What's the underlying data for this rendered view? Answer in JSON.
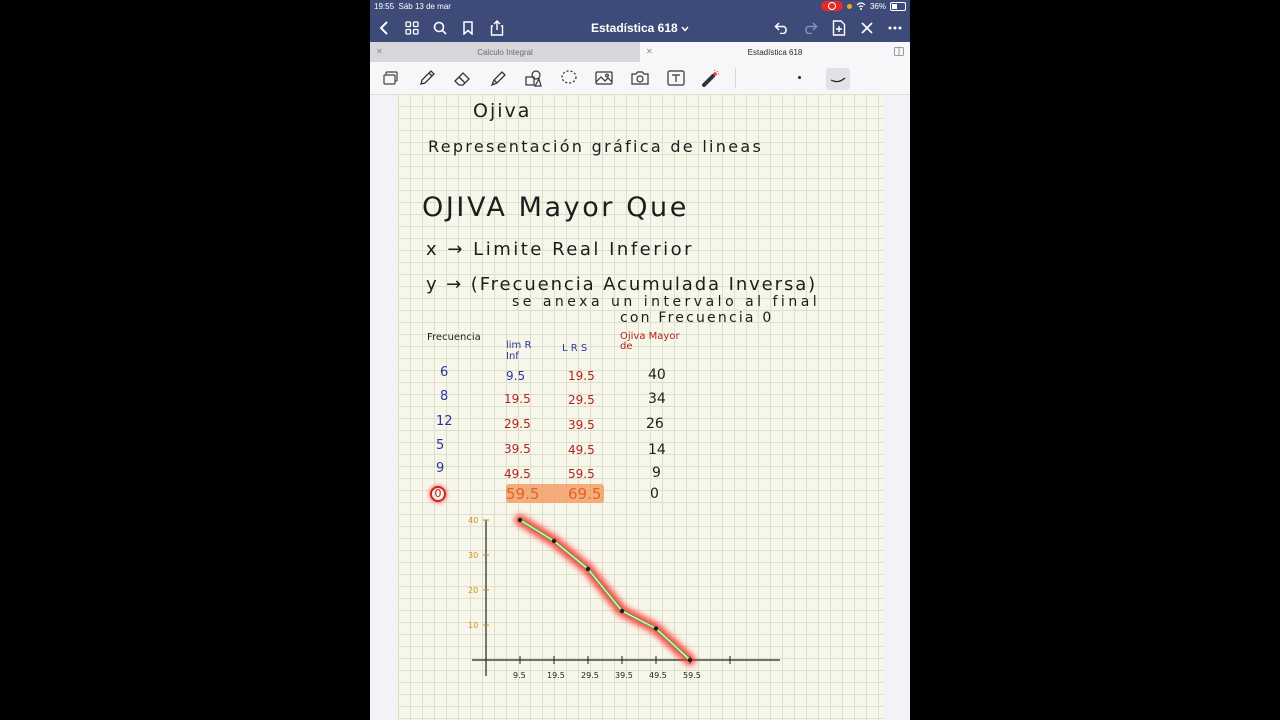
{
  "status_bar": {
    "time": "19:55",
    "date": "Sáb 13 de mar",
    "battery": "36%"
  },
  "nav": {
    "title": "Estadística 618"
  },
  "tabs": [
    {
      "label": "Calculo Integral"
    },
    {
      "label": "Estadística 618"
    }
  ],
  "toolbar": {
    "icons": [
      "page-view-icon",
      "pen-icon",
      "eraser-icon",
      "highlighter-icon",
      "shapes-icon",
      "lasso-icon",
      "image-icon",
      "camera-icon",
      "text-icon",
      "laser-pointer-icon"
    ]
  },
  "notes": {
    "heading1": "Ojiva",
    "definition": "Representación gráfica de lineas",
    "heading2": "OJIVA Mayor Que",
    "x_line": "x → Limite Real Inferior",
    "y_line": "y → (Frecuencia Acumulada Inversa)",
    "y_note1": "se anexa un intervalo al final",
    "y_note2": "con Frecuencia 0"
  },
  "table": {
    "headers": {
      "frecuencia": "Frecuencia",
      "lim_r_inf": "lim R Inf",
      "lrs": "L R S",
      "ojiva": "Ojiva Mayor de"
    },
    "rows": [
      {
        "f": "6",
        "lri": "9.5",
        "lrs": "19.5",
        "ojiva": "40"
      },
      {
        "f": "8",
        "lri": "19.5",
        "lrs": "29.5",
        "ojiva": "34"
      },
      {
        "f": "12",
        "lri": "29.5",
        "lrs": "39.5",
        "ojiva": "26"
      },
      {
        "f": "5",
        "lri": "39.5",
        "lrs": "49.5",
        "ojiva": "14"
      },
      {
        "f": "9",
        "lri": "49.5",
        "lrs": "59.5",
        "ojiva": "9"
      },
      {
        "f": "0",
        "lri": "59.5",
        "lrs": "69.5",
        "ojiva": "0"
      }
    ]
  },
  "chart_data": {
    "type": "line",
    "x": [
      9.5,
      19.5,
      29.5,
      39.5,
      49.5,
      59.5
    ],
    "y": [
      40,
      34,
      26,
      14,
      9,
      0
    ],
    "x_ticks": [
      "9.5",
      "19.5",
      "29.5",
      "39.5",
      "49.5",
      "59.5"
    ],
    "y_ticks": [
      "10",
      "20",
      "30",
      "40"
    ],
    "colors": {
      "line": "#7a9f3a",
      "glow": "#ff2a2a",
      "axis": "#222222",
      "y_ticks": "#d98a1e"
    }
  }
}
